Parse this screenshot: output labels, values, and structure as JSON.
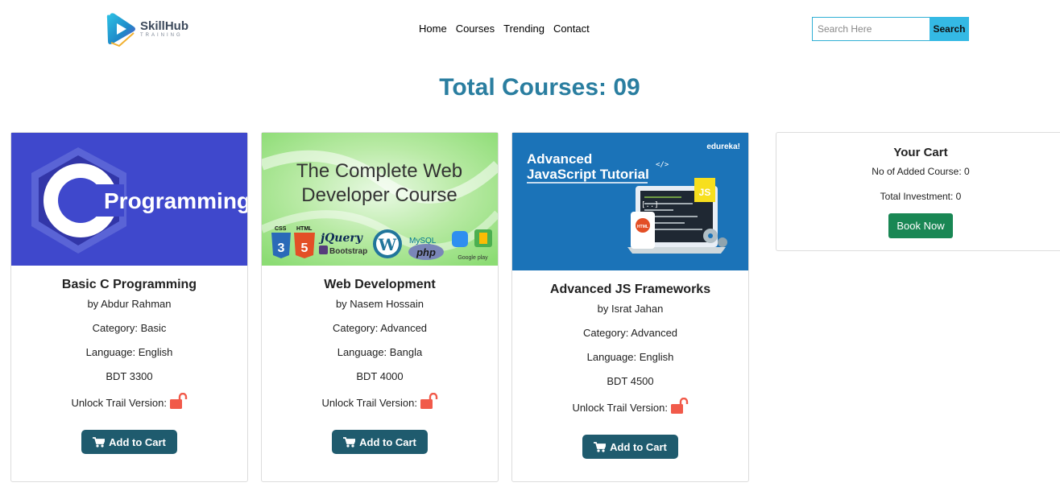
{
  "header": {
    "logo_name": "SkillHub",
    "logo_sub": "TRAINING",
    "nav": [
      "Home",
      "Courses",
      "Trending",
      "Contact"
    ],
    "search_placeholder": "Search Here",
    "search_button": "Search"
  },
  "title": "Total Courses: 09",
  "courses": [
    {
      "title": "Basic C Programming",
      "author": "by Abdur Rahman",
      "category": "Category: Basic",
      "language": "Language: English",
      "price": "BDT 3300",
      "unlock": "Unlock Trail Version:",
      "button": "Add to Cart",
      "thumb_text": "Programming",
      "thumb_letter": "C",
      "thumb_color": "#3f48cc"
    },
    {
      "title": "Web Development",
      "author": "by Nasem Hossain",
      "category": "Category: Advanced",
      "language": "Language: Bangla",
      "price": "BDT 4000",
      "unlock": "Unlock Trail Version:",
      "button": "Add to Cart",
      "thumb_line1": "The Complete Web",
      "thumb_line2": "Developer Course",
      "thumb_logos": {
        "css": "CSS",
        "css_num": "3",
        "html": "HTML",
        "html_num": "5",
        "jquery": "jQuery",
        "bootstrap": "Bootstrap",
        "wp": "W",
        "mysql": "MySQL",
        "php": "php",
        "gplay": "Google play"
      }
    },
    {
      "title": "Advanced JS Frameworks",
      "author": "by Israt Jahan",
      "category": "Category: Advanced",
      "language": "Language: English",
      "price": "BDT 4500",
      "unlock": "Unlock Trail Version:",
      "button": "Add to Cart",
      "thumb_brand": "edureka!",
      "thumb_line1": "Advanced",
      "thumb_line2": "JavaScript Tutorial",
      "thumb_js": "JS",
      "thumb_html": "HTML",
      "thumb_tag": "</>",
      "thumb_bracket": "[..]"
    }
  ],
  "cart": {
    "title": "Your Cart",
    "added": "No of Added Course: 0",
    "total": "Total Investment: 0",
    "button": "Book Now"
  },
  "colors": {
    "accent": "#2a7ea0",
    "cart_button": "#1f5b6e",
    "book_button": "#198754",
    "search_button": "#34b9e4",
    "lock": "#f15a4a"
  }
}
